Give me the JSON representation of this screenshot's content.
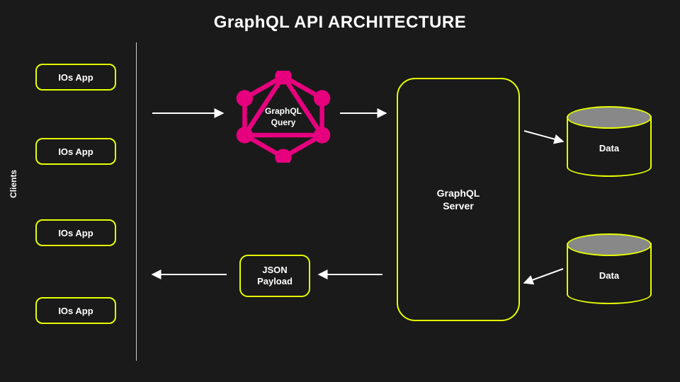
{
  "title": "GraphQL API ARCHITECTURE",
  "sidebar_label": "Clients",
  "clients": {
    "c1": "IOs App",
    "c2": "IOs App",
    "c3": "IOs App",
    "c4": "IOs App"
  },
  "graphql_logo": {
    "line1": "GraphQL",
    "line2": "Query"
  },
  "json_box": {
    "line1": "JSON",
    "line2": "Payload"
  },
  "server": {
    "line1": "GraphQL",
    "line2": "Server"
  },
  "db": {
    "d1": "Data",
    "d2": "Data"
  },
  "colors": {
    "accent": "#e6ff00",
    "logo": "#e6007e",
    "bg": "#1a1a1a"
  }
}
